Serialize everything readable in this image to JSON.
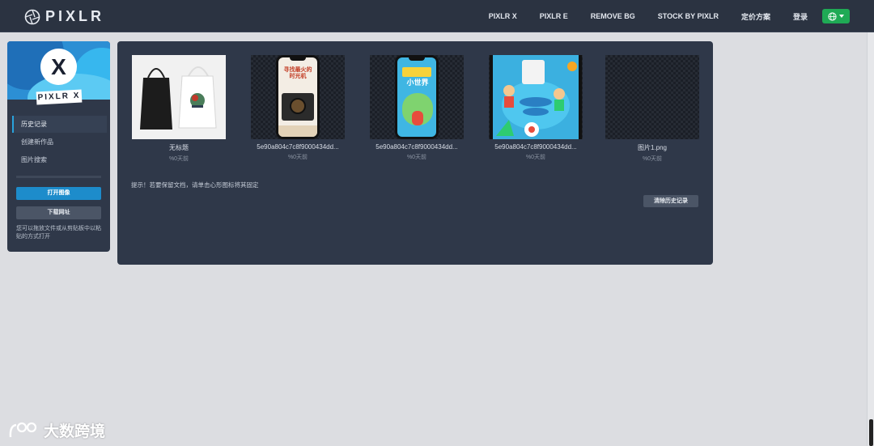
{
  "brand": {
    "name": "PIXLR"
  },
  "nav": {
    "items": [
      "PIXLR X",
      "PIXLR E",
      "REMOVE BG",
      "STOCK BY PIXLR",
      "定价方案",
      "登录"
    ],
    "language_icon": "globe-icon"
  },
  "sidebar": {
    "app_badge": "X",
    "app_label": "PIXLR X",
    "menu": [
      {
        "label": "历史记录",
        "active": true
      },
      {
        "label": "创建新作品",
        "active": false
      },
      {
        "label": "图片搜索",
        "active": false
      }
    ],
    "open_image_label": "打开图像",
    "load_url_label": "下载网址",
    "hint": "您可以拖放文件或从剪贴板中以粘贴的方式打开"
  },
  "history": {
    "items": [
      {
        "name": "无标题",
        "time": "%0天前"
      },
      {
        "name": "5e90a804c7c8f9000434dd...",
        "time": "%0天前"
      },
      {
        "name": "5e90a804c7c8f9000434dd...",
        "time": "%0天前"
      },
      {
        "name": "5e90a804c7c8f9000434dd...",
        "time": "%0天前"
      },
      {
        "name": "图片1.png",
        "time": "%0天前"
      }
    ],
    "thumb_texts": [
      "寻找最火的时光机",
      "小世界"
    ],
    "tip": "提示！若要保留文档，请单击心形图标将其固定",
    "clear_label": "清除历史记录"
  },
  "watermark": {
    "text": "大数跨境"
  },
  "colors": {
    "topbar": "#2b3341",
    "panel": "#2f3849",
    "accent_blue": "#1d8ccb",
    "language_green": "#1faa55",
    "page_bg": "#dcdde1"
  }
}
